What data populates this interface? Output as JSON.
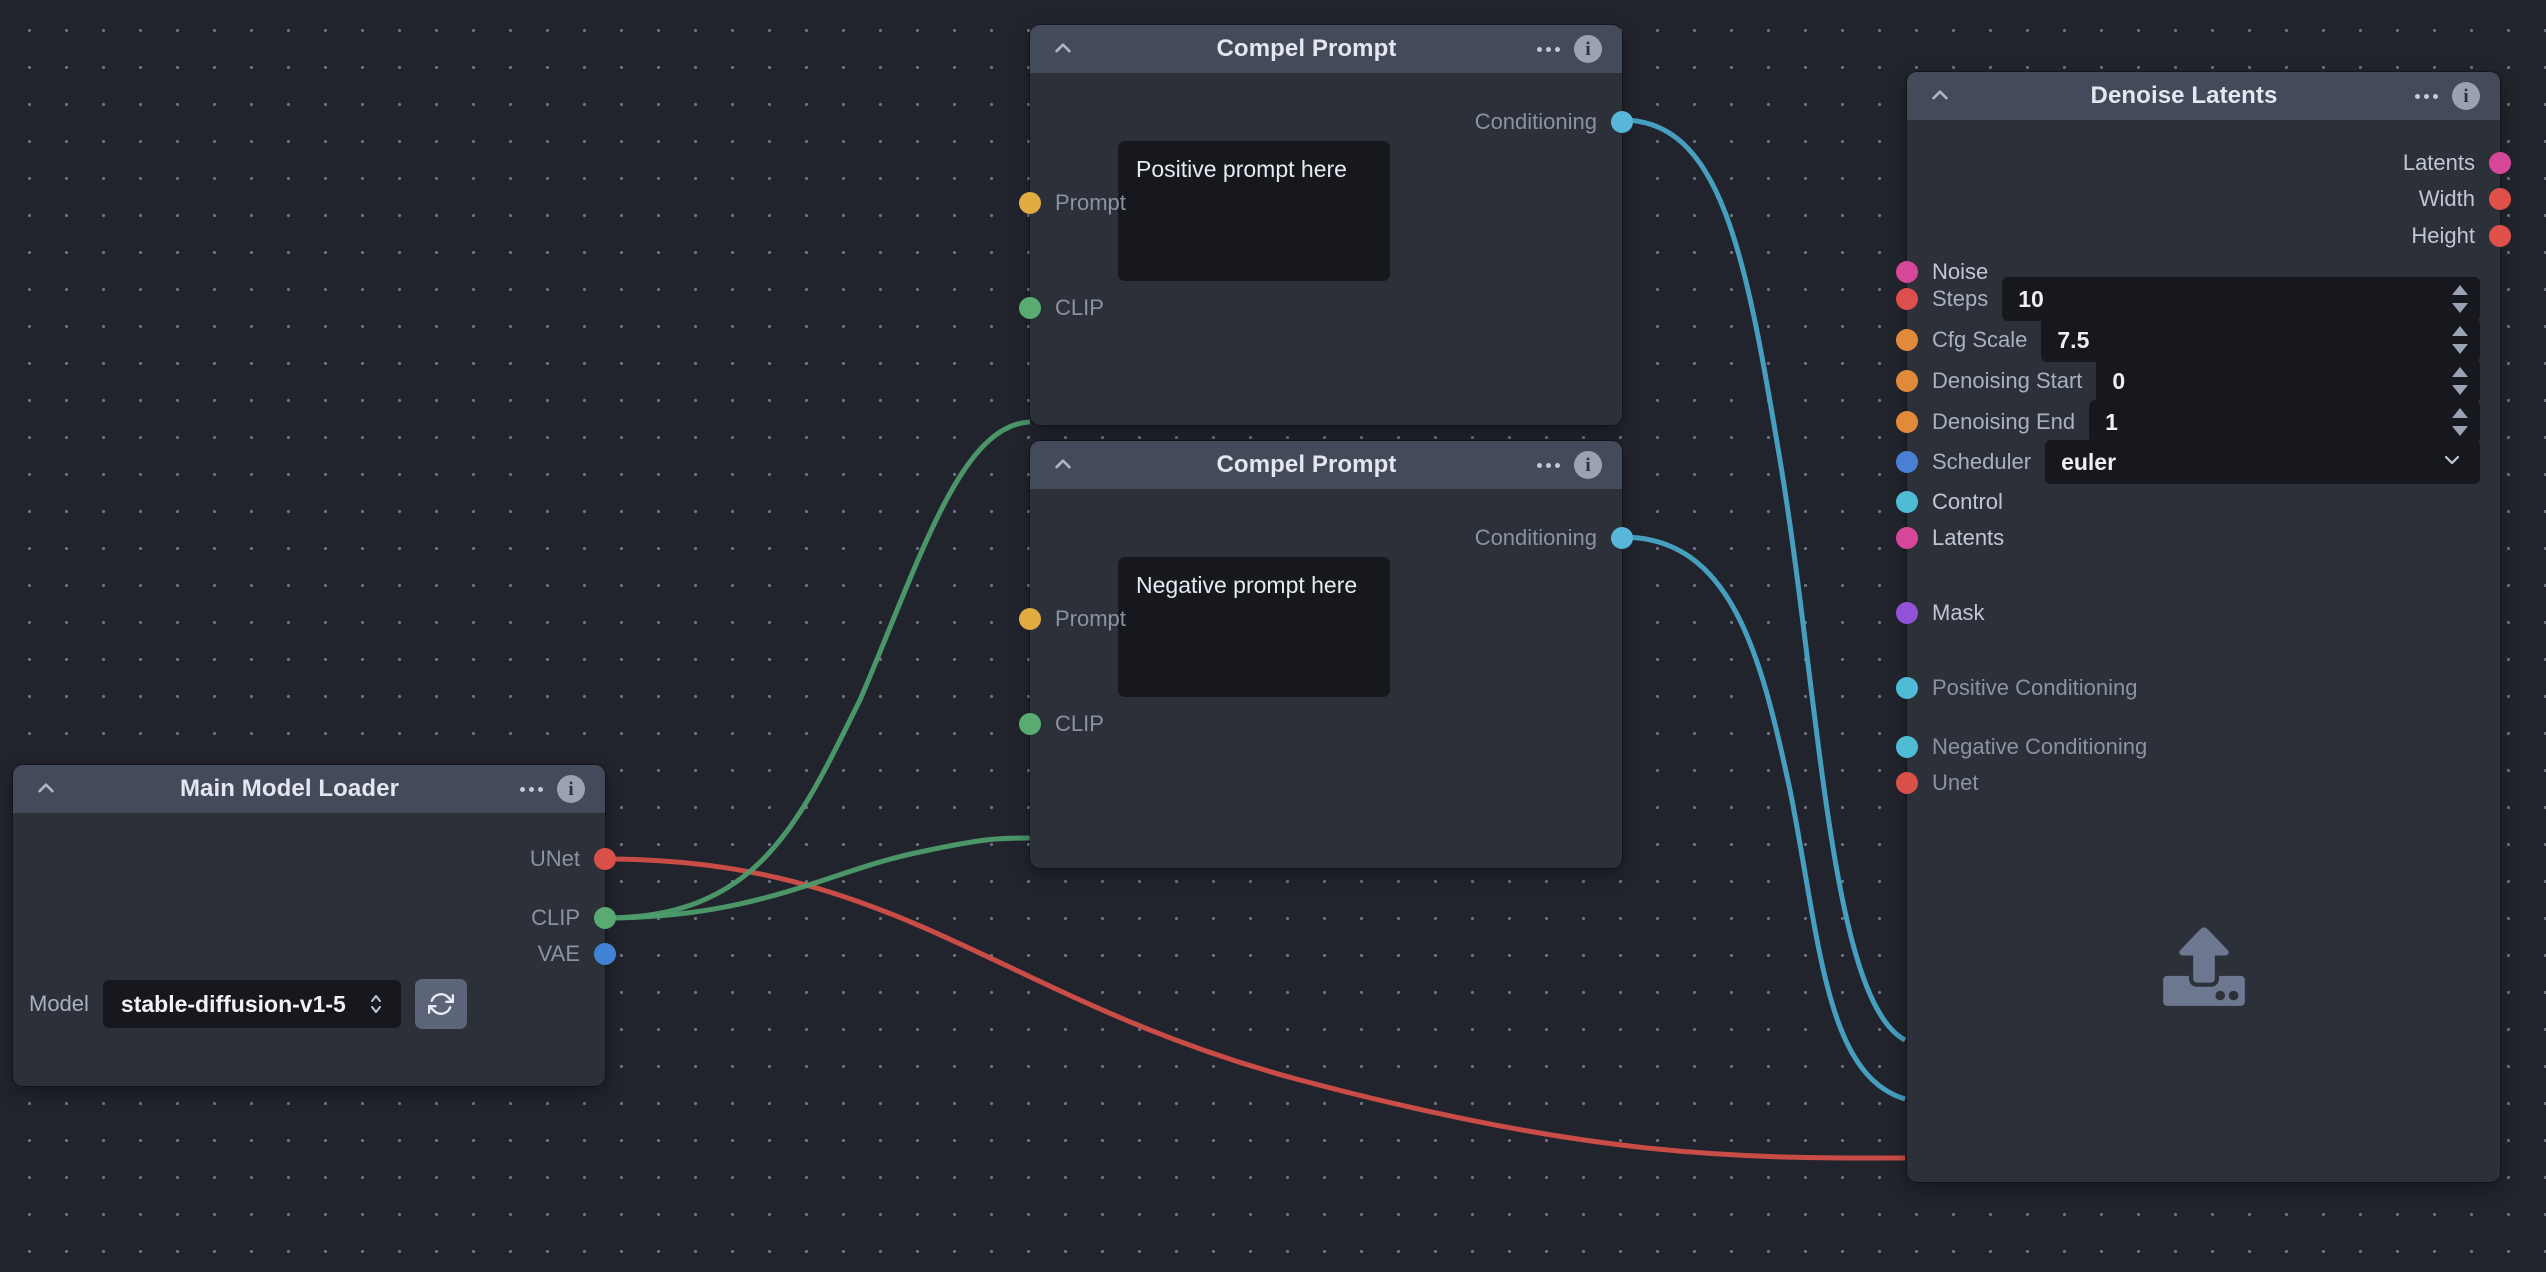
{
  "canvas": {
    "background": "#21242c",
    "grid_dot_color": "#6b7280"
  },
  "palette": {
    "conditioning": "#58b6d9",
    "clip": "#5aab72",
    "unet": "#d9504a",
    "vae": "#4083d4",
    "latents": "#d6479a",
    "width_height": "#e05049",
    "steps": "#dd4f4c",
    "cfg": "#e08a3a",
    "denoising": "#e08a3a",
    "scheduler": "#4a7fd4",
    "control": "#4fbcd6",
    "mask": "#9352d8",
    "prompt": "#e0ab41",
    "node_header": "#434a5a",
    "node_body": "#2c3039",
    "input_bg": "#16181d"
  },
  "nodes": [
    {
      "id": "compel-positive",
      "title": "Compel Prompt",
      "collapse_icon": "chevron-up-icon",
      "menu_icon": "ellipsis-icon",
      "info_icon": "info-icon",
      "outputs": [
        {
          "label": "Conditioning",
          "color": "#58b6d9"
        }
      ],
      "inputs": [
        {
          "label": "Prompt",
          "color": "#e0ab41"
        },
        {
          "label": "CLIP",
          "color": "#5aab72"
        }
      ],
      "textarea_value": "Positive prompt here"
    },
    {
      "id": "compel-negative",
      "title": "Compel Prompt",
      "collapse_icon": "chevron-up-icon",
      "menu_icon": "ellipsis-icon",
      "info_icon": "info-icon",
      "outputs": [
        {
          "label": "Conditioning",
          "color": "#58b6d9"
        }
      ],
      "inputs": [
        {
          "label": "Prompt",
          "color": "#e0ab41"
        },
        {
          "label": "CLIP",
          "color": "#5aab72"
        }
      ],
      "textarea_value": "Negative prompt here"
    },
    {
      "id": "main-model-loader",
      "title": "Main Model Loader",
      "collapse_icon": "chevron-up-icon",
      "menu_icon": "ellipsis-icon",
      "info_icon": "info-icon",
      "outputs": [
        {
          "label": "UNet",
          "color": "#d9504a"
        },
        {
          "label": "CLIP",
          "color": "#5aab72"
        },
        {
          "label": "VAE",
          "color": "#4083d4"
        }
      ],
      "model_field": {
        "label": "Model",
        "value": "stable-diffusion-v1-5",
        "chevron_icon": "chevron-up-down-icon",
        "refresh_icon": "refresh-icon"
      }
    },
    {
      "id": "denoise-latents",
      "title": "Denoise Latents",
      "collapse_icon": "chevron-up-icon",
      "menu_icon": "ellipsis-icon",
      "info_icon": "info-icon",
      "outputs": [
        {
          "label": "Latents",
          "color": "#d6479a"
        },
        {
          "label": "Width",
          "color": "#e05049"
        },
        {
          "label": "Height",
          "color": "#e05049"
        }
      ],
      "inputs": [
        {
          "label": "Noise",
          "color": "#d6479a",
          "widget": "none"
        },
        {
          "label": "Steps",
          "color": "#dd4f4c",
          "widget": "number",
          "value": "10"
        },
        {
          "label": "Cfg Scale",
          "color": "#e08a3a",
          "widget": "number",
          "value": "7.5"
        },
        {
          "label": "Denoising Start",
          "color": "#e08a3a",
          "widget": "number",
          "value": "0"
        },
        {
          "label": "Denoising End",
          "color": "#e08a3a",
          "widget": "number",
          "value": "1"
        },
        {
          "label": "Scheduler",
          "color": "#4a7fd4",
          "widget": "select",
          "value": "euler"
        },
        {
          "label": "Control",
          "color": "#4fbcd6",
          "widget": "none"
        },
        {
          "label": "Latents",
          "color": "#d6479a",
          "widget": "none"
        },
        {
          "label": "Mask",
          "color": "#9352d8",
          "widget": "none"
        },
        {
          "label": "Positive Conditioning",
          "color": "#4fbcd6",
          "widget": "none"
        },
        {
          "label": "Negative Conditioning",
          "color": "#4fbcd6",
          "widget": "none"
        },
        {
          "label": "Unet",
          "color": "#d9504a",
          "widget": "none"
        }
      ],
      "upload_icon": "upload-icon"
    }
  ]
}
